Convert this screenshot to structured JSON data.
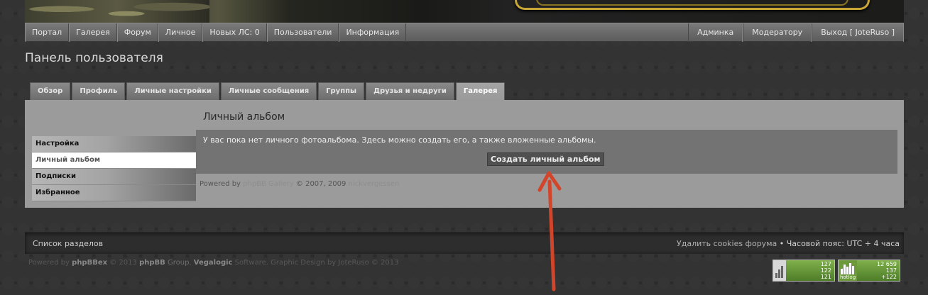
{
  "nav": {
    "left": [
      "Портал",
      "Галерея",
      "Форум",
      "Личное",
      "Новых ЛС: 0",
      "Пользователи",
      "Информация"
    ],
    "right": [
      "Админка",
      "Модератору",
      "Выход [ JoteRuso ]"
    ]
  },
  "page_title": "Панель пользователя",
  "tabs": [
    "Обзор",
    "Профиль",
    "Личные настройки",
    "Личные сообщения",
    "Группы",
    "Друзья и недруги",
    "Галерея"
  ],
  "active_tab": "Галерея",
  "side_menu": [
    "Настройка",
    "Личный альбом",
    "Подписки",
    "Избранное"
  ],
  "active_side": "Личный альбом",
  "content": {
    "title": "Личный альбом",
    "message": "У вас пока нет личного фотоальбома. Здесь можно создать его, а также вложенные альбомы.",
    "create_button": "Создать личный альбом",
    "powered_by": "Powered by",
    "powered_name": "phpBB Gallery",
    "powered_year": "© 2007, 2009",
    "powered_author": "nickvergessen"
  },
  "footer": {
    "left": "Список разделов",
    "delete_cookies": "Удалить cookies форума",
    "bullet": "•",
    "tz_label": "Часовой пояс:",
    "tz_value": "UTC + 4 часа"
  },
  "copyright": {
    "powered": "Powered by",
    "phpbbex": "phpBBex",
    "year1": "© 2013",
    "phpbb": "phpBB",
    "group": "Group.",
    "vegalogic": "Vegalogic",
    "software": "Software. Graphic Design by JoteRuso © 2013"
  },
  "counters": {
    "c1": [
      "127",
      "122",
      "121"
    ],
    "c2": [
      "12 659",
      "137",
      "+122"
    ],
    "c2_label": "hotlog"
  },
  "colors": {
    "accent_arrow": "#d2452a",
    "panel_bg": "#9b9b9b",
    "nav_bg": "#6b6b6b"
  }
}
